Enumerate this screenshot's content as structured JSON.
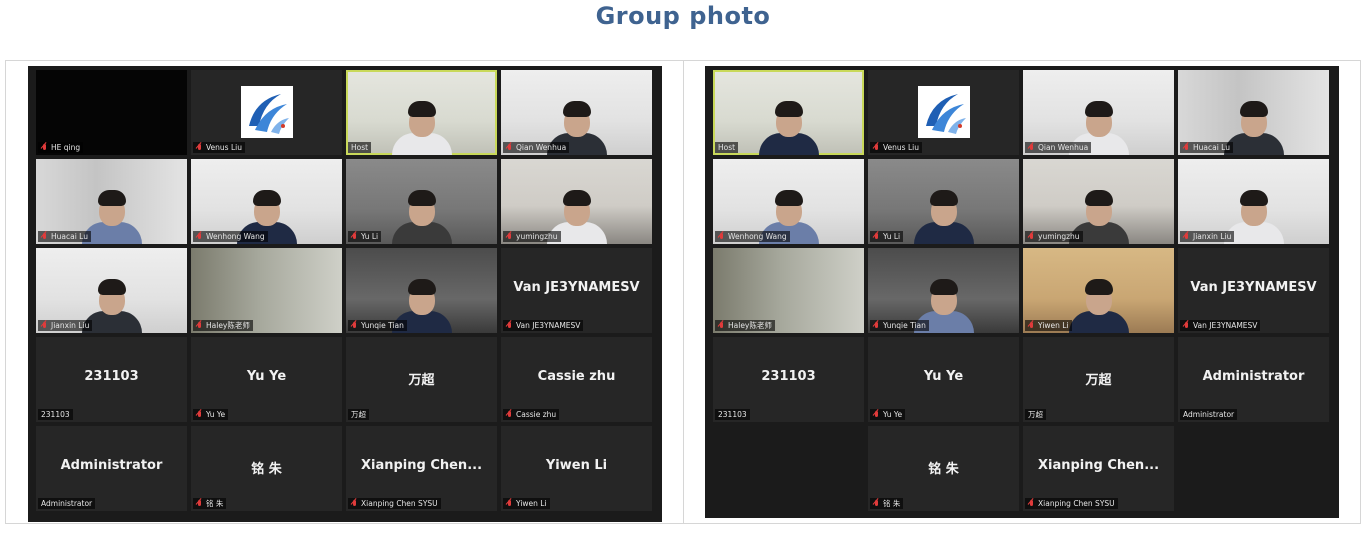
{
  "title": "Group photo",
  "left": {
    "tiles": [
      {
        "label": "HE qing",
        "muted": true,
        "bg": "black",
        "person": false
      },
      {
        "label": "Venus Liu",
        "muted": true,
        "bg": "dark-logo",
        "person": false
      },
      {
        "label": "Host",
        "muted": false,
        "bg": "green",
        "person": true,
        "host": true
      },
      {
        "label": "Qian Wenhua",
        "muted": true,
        "bg": "white",
        "person": true
      },
      {
        "label": "Huacai Lu",
        "muted": true,
        "bg": "shelf",
        "person": true
      },
      {
        "label": "Wenhong Wang",
        "muted": true,
        "bg": "white",
        "person": true
      },
      {
        "label": "Yu Li",
        "muted": true,
        "bg": "gray",
        "person": true
      },
      {
        "label": "yumingzhu",
        "muted": true,
        "bg": "office",
        "person": true
      },
      {
        "label": "Jianxin Liu",
        "muted": true,
        "bg": "white",
        "person": true
      },
      {
        "label": "Haley陈老师",
        "muted": true,
        "bg": "window",
        "person": false
      },
      {
        "label": "Yunqie Tian",
        "muted": true,
        "bg": "dark",
        "person": true
      },
      {
        "label": "Van JE3YNAMESV",
        "muted": true,
        "big": "Van JE3YNAMESV"
      },
      {
        "label": "231103",
        "muted": false,
        "big": "231103"
      },
      {
        "label": "Yu Ye",
        "muted": true,
        "big": "Yu Ye"
      },
      {
        "label": "万超",
        "muted": false,
        "big": "万超"
      },
      {
        "label": "Cassie zhu",
        "muted": true,
        "big": "Cassie zhu"
      },
      {
        "label": "Administrator",
        "muted": false,
        "big": "Administrator"
      },
      {
        "label": "铭 朱",
        "muted": true,
        "big": "铭 朱"
      },
      {
        "label": "Xianping Chen SYSU",
        "muted": true,
        "big": "Xianping  Chen..."
      },
      {
        "label": "Yiwen Li",
        "muted": true,
        "big": "Yiwen Li"
      }
    ]
  },
  "right": {
    "tiles": [
      {
        "label": "Host",
        "muted": false,
        "bg": "green",
        "person": true,
        "host": true
      },
      {
        "label": "Venus Liu",
        "muted": true,
        "bg": "dark-logo",
        "person": false
      },
      {
        "label": "Qian Wenhua",
        "muted": true,
        "bg": "white",
        "person": true
      },
      {
        "label": "Huacai Lu",
        "muted": true,
        "bg": "shelf",
        "person": true
      },
      {
        "label": "Wenhong Wang",
        "muted": true,
        "bg": "white",
        "person": true
      },
      {
        "label": "Yu Li",
        "muted": true,
        "bg": "gray",
        "person": true
      },
      {
        "label": "yumingzhu",
        "muted": true,
        "bg": "office",
        "person": true
      },
      {
        "label": "Jianxin Liu",
        "muted": true,
        "bg": "white",
        "person": true
      },
      {
        "label": "Haley陈老师",
        "muted": true,
        "bg": "window",
        "person": false
      },
      {
        "label": "Yunqie Tian",
        "muted": true,
        "bg": "dark",
        "person": true
      },
      {
        "label": "Yiwen Li",
        "muted": true,
        "bg": "warm",
        "person": true
      },
      {
        "label": "Van JE3YNAMESV",
        "muted": true,
        "big": "Van JE3YNAMESV"
      },
      {
        "label": "231103",
        "muted": false,
        "big": "231103"
      },
      {
        "label": "Yu Ye",
        "muted": true,
        "big": "Yu Ye"
      },
      {
        "label": "万超",
        "muted": false,
        "big": "万超"
      },
      {
        "label": "Administrator",
        "muted": false,
        "big": "Administrator"
      },
      {
        "label": "",
        "empty": true
      },
      {
        "label": "铭 朱",
        "muted": true,
        "big": "铭 朱"
      },
      {
        "label": "Xianping Chen SYSU",
        "muted": true,
        "big": "Xianping  Chen..."
      },
      {
        "label": "",
        "empty": true
      }
    ]
  }
}
